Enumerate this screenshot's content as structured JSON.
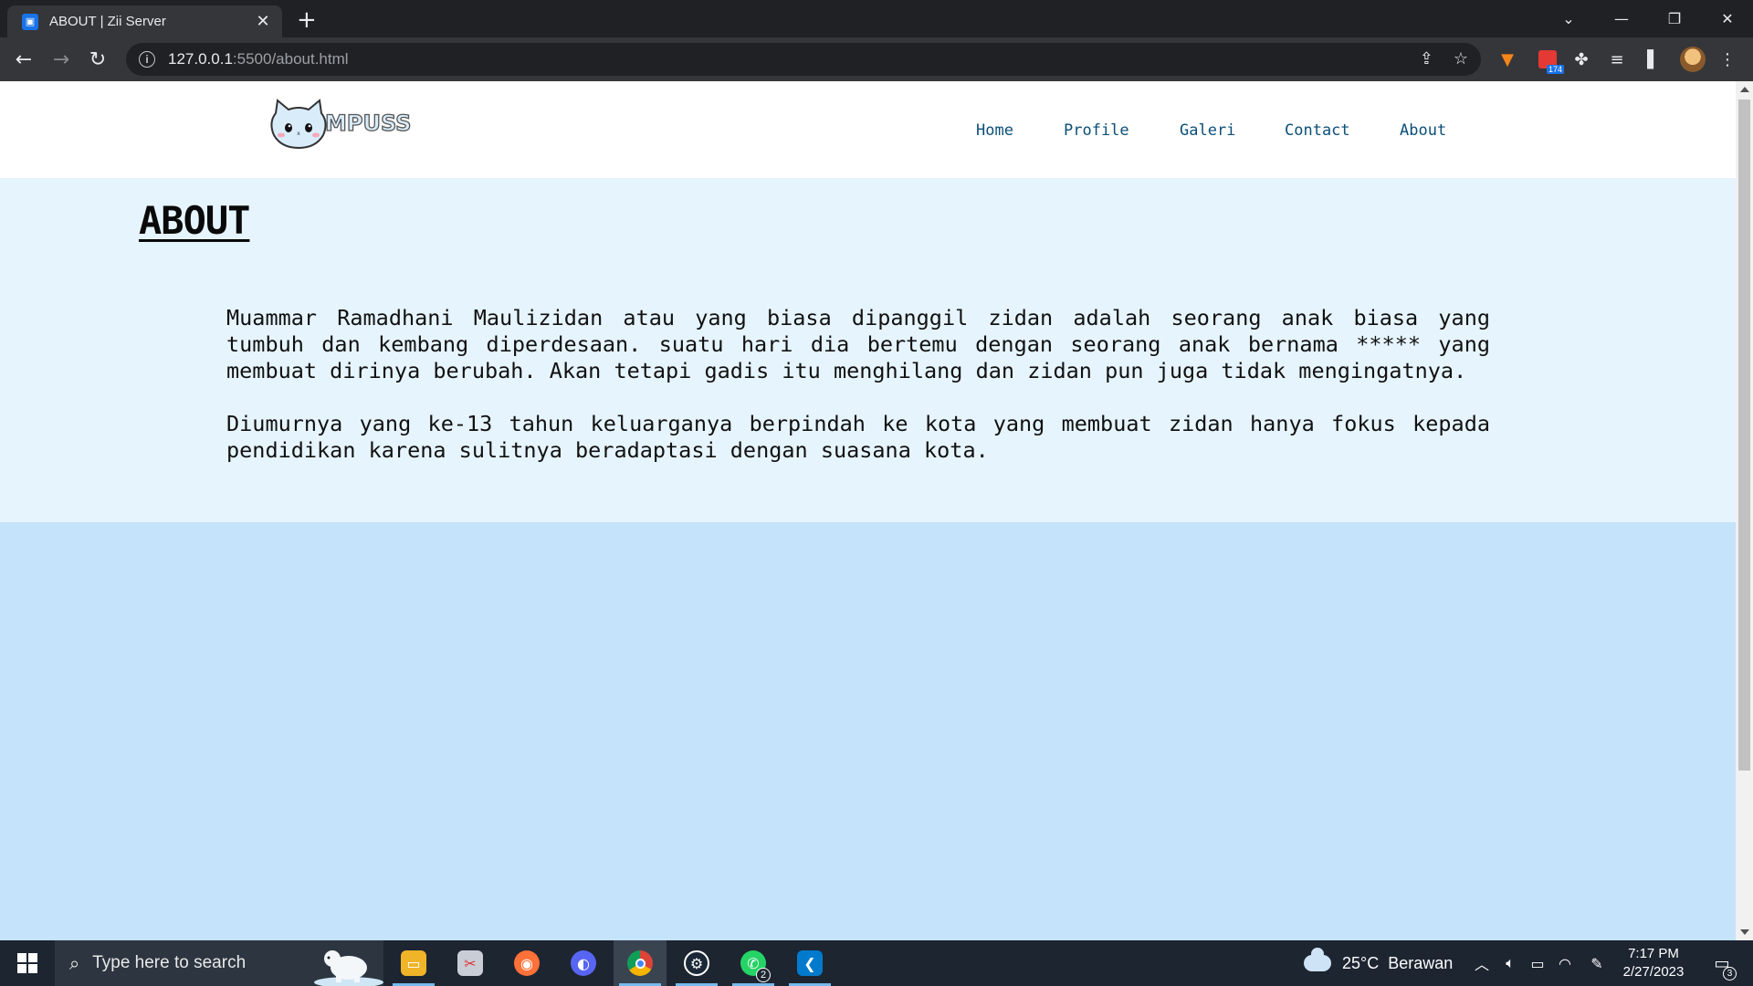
{
  "browser": {
    "tab_title": "ABOUT | Zii Server",
    "url_host": "127.0.0.1",
    "url_path": ":5500/about.html",
    "extension_badge": "174"
  },
  "site": {
    "logo_text": "MPUSS",
    "nav": [
      "Home",
      "Profile",
      "Galeri",
      "Contact",
      "About"
    ],
    "about": {
      "title": "ABOUT",
      "paragraphs": [
        "Muammar Ramadhani Maulizidan atau yang biasa dipanggil zidan adalah seorang anak biasa yang tumbuh dan kembang diperdesaan. suatu hari dia bertemu dengan seorang anak bernama ***** yang membuat dirinya berubah. Akan tetapi gadis itu menghilang dan zidan pun juga tidak mengingatnya.",
        "Diumurnya yang ke-13 tahun keluarganya berpindah ke kota yang membuat zidan hanya fokus kepada pendidikan karena sulitnya beradaptasi dengan suasana kota."
      ]
    },
    "colors": {
      "header_bg": "#ffffff",
      "section_bg": "#e6f4fd",
      "page_bg": "#c5e3fb",
      "nav_link": "#0b4f78"
    }
  },
  "taskbar": {
    "search_placeholder": "Type here to search",
    "whatsapp_badge": "2",
    "weather_temp": "25°C",
    "weather_desc": "Berawan",
    "time": "7:17 PM",
    "date": "2/27/2023",
    "notification_count": "3"
  }
}
